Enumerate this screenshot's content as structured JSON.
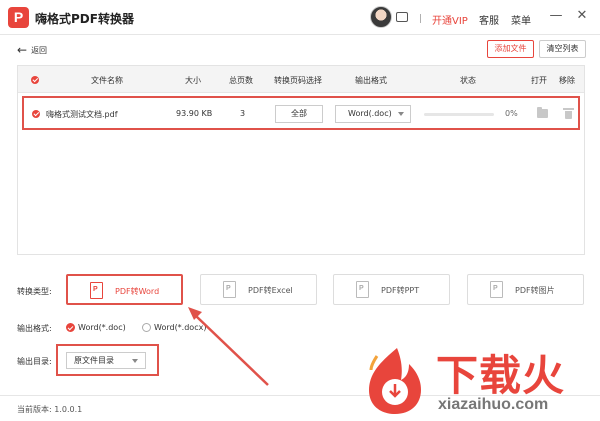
{
  "app": {
    "logo_letter": "P",
    "title": "嗨格式PDF转换器"
  },
  "header": {
    "separator": "|",
    "vip_label": "开通VIP",
    "service_label": "客服",
    "menu_label": "菜单",
    "minimize": "—",
    "close": "✕"
  },
  "toolbar": {
    "back_arrow": "←",
    "back_label": "返回",
    "add_file_label": "添加文件",
    "clear_list_label": "清空列表"
  },
  "table": {
    "headers": {
      "name": "文件名称",
      "size": "大小",
      "pages": "总页数",
      "page_select": "转换页码选择",
      "format": "输出格式",
      "status": "状态",
      "open": "打开",
      "remove": "移除"
    },
    "rows": [
      {
        "name": "嗨格式测试文档.pdf",
        "size": "93.90 KB",
        "pages": "3",
        "page_select": "全部",
        "format": "Word(.doc)",
        "progress": 0,
        "progress_text": "0%"
      }
    ]
  },
  "convert_type": {
    "label": "转换类型:",
    "options": [
      {
        "icon_letter": "P",
        "label": "PDF转Word",
        "active": true
      },
      {
        "icon_letter": "P",
        "label": "PDF转Excel",
        "active": false
      },
      {
        "icon_letter": "P",
        "label": "PDF转PPT",
        "active": false
      },
      {
        "icon_letter": "P",
        "label": "PDF转图片",
        "active": false
      }
    ]
  },
  "output_format": {
    "label": "输出格式:",
    "options": [
      {
        "label": "Word(*.doc)",
        "checked": true
      },
      {
        "label": "Word(*.docx)",
        "checked": false
      }
    ]
  },
  "output_dir": {
    "label": "输出目录:",
    "value": "原文件目录"
  },
  "footer": {
    "version": "当前版本: 1.0.0.1"
  },
  "watermark": {
    "text": "下载火",
    "url": "xiazaihuo.com"
  },
  "colors": {
    "accent": "#e8453c",
    "highlight_border": "#e0524a"
  }
}
